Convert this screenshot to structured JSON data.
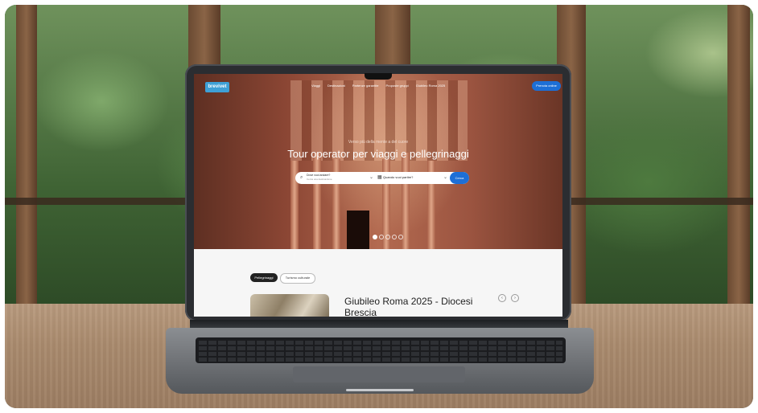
{
  "site": {
    "logo_text": "brevivet",
    "nav": [
      "Viaggi",
      "Destinazioni",
      "Partenze garantite",
      "Proposte gruppi",
      "Giubileo Roma 2025"
    ],
    "cta_label": "Prenota online"
  },
  "hero": {
    "kicker": "Verso più della mente a del cuore",
    "headline": "Tour operator per viaggi e pellegrinaggi",
    "search": {
      "where_label": "Dove vuoi andare?",
      "where_placeholder": "Cerca una destinazione",
      "when_label": "Quando vuoi partire?",
      "button_label": "Cerca"
    },
    "slider_dots": 5,
    "slider_active": 1
  },
  "content": {
    "tabs": [
      "Pellegrinaggi",
      "Turismo culturale"
    ],
    "card_title": "Giubileo Roma 2025 - Diocesi Brescia",
    "prev_icon": "chevron-left-icon",
    "next_icon": "chevron-right-icon"
  }
}
